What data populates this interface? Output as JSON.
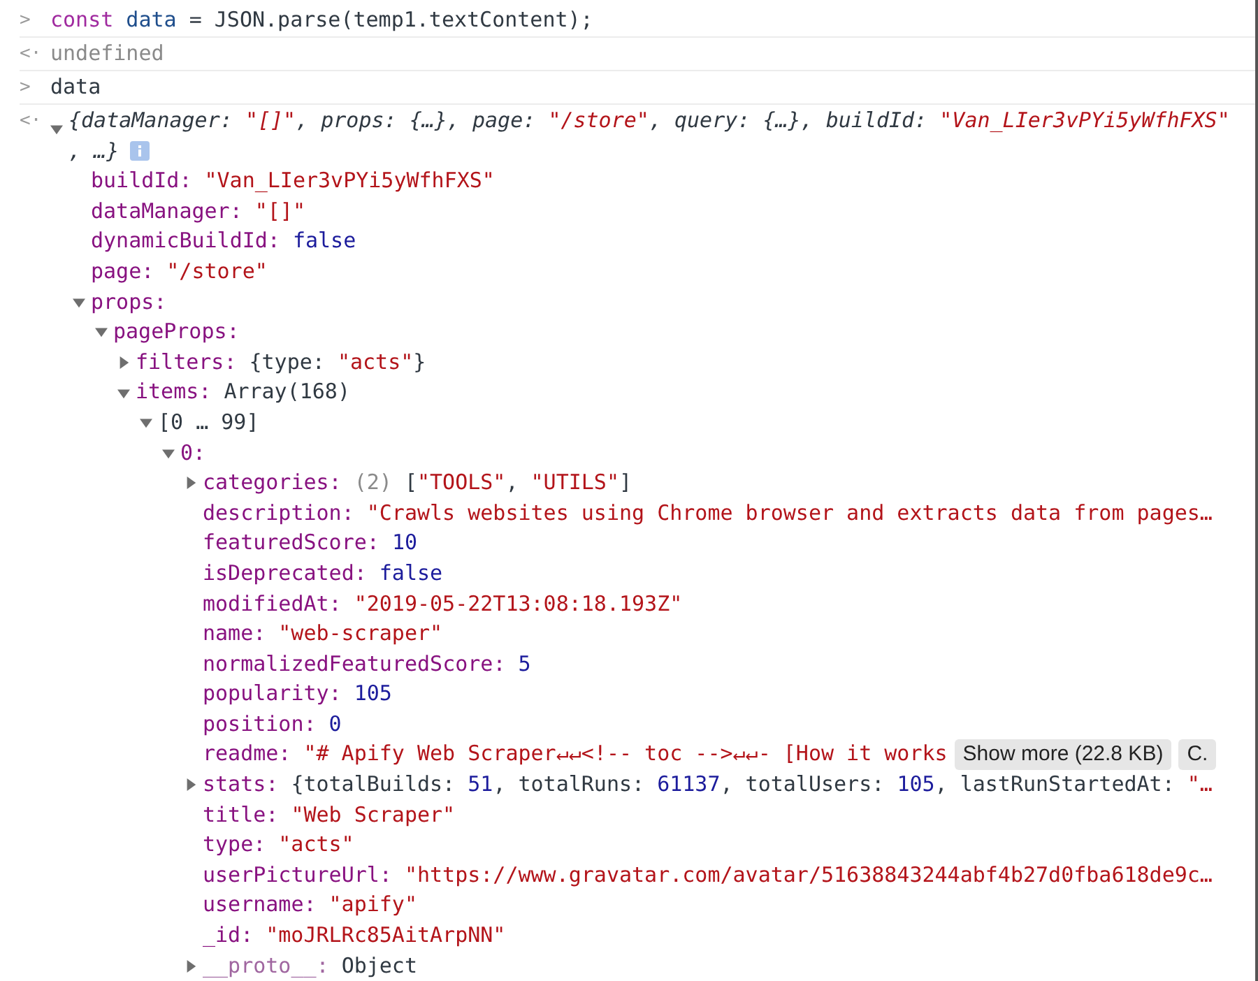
{
  "console": [
    {
      "kind": "input",
      "prompt": ">",
      "tokens": [
        {
          "kind": "keyword_purple",
          "text": "const"
        },
        {
          "kind": "variable",
          "text": " data"
        },
        {
          "kind": "plain",
          "text": " = JSON.parse(temp1.textContent);"
        }
      ]
    },
    {
      "kind": "output",
      "prompt": "<·",
      "tokens": [
        {
          "kind": "muted",
          "text": "undefined"
        }
      ]
    },
    {
      "kind": "input",
      "prompt": ">",
      "tokens": [
        {
          "kind": "plain",
          "text": "data"
        }
      ]
    },
    {
      "kind": "object",
      "prompt": "<·",
      "expanded": true,
      "summary": [
        {
          "kind": "plain",
          "text": "{dataManager: "
        },
        {
          "kind": "string",
          "text": "\"[]\""
        },
        {
          "kind": "plain",
          "text": ", props: {…}, page: "
        },
        {
          "kind": "string",
          "text": "\"/store\""
        },
        {
          "kind": "plain",
          "text": ", query: {…}, buildId: "
        },
        {
          "kind": "string",
          "text": "\"Van_LIer3vPYi5yWfhFXS"
        },
        {
          "kind": "string",
          "text": "\""
        },
        {
          "kind": "plain",
          "text": ", …}"
        }
      ],
      "children": [
        {
          "key": "buildId:",
          "value": [
            {
              "kind": "string",
              "text": "\"Van_LIer3vPYi5yWfhFXS\""
            }
          ]
        },
        {
          "key": "dataManager:",
          "value": [
            {
              "kind": "string",
              "text": "\"[]\""
            }
          ]
        },
        {
          "key": "dynamicBuildId:",
          "value": [
            {
              "kind": "number",
              "text": "false"
            }
          ]
        },
        {
          "key": "page:",
          "value": [
            {
              "kind": "string",
              "text": "\"/store\""
            }
          ]
        },
        {
          "key": "props:",
          "expanded": true,
          "children": [
            {
              "key": "pageProps:",
              "expanded": true,
              "children": [
                {
                  "key": "filters:",
                  "expanded": false,
                  "value": [
                    {
                      "kind": "plain",
                      "text": "{type: "
                    },
                    {
                      "kind": "string",
                      "text": "\"acts\""
                    },
                    {
                      "kind": "plain",
                      "text": "}"
                    }
                  ]
                },
                {
                  "key": "items:",
                  "expanded": true,
                  "value": [
                    {
                      "kind": "plain",
                      "text": "Array(168)"
                    }
                  ],
                  "children": [
                    {
                      "key": "[0 … 99]",
                      "plain_key": true,
                      "expanded": true,
                      "children": [
                        {
                          "key": "0:",
                          "expanded": true,
                          "children": [
                            {
                              "key": "categories:",
                              "expanded": false,
                              "value": [
                                {
                                  "kind": "muted",
                                  "text": "(2)"
                                },
                                {
                                  "kind": "plain",
                                  "text": " ["
                                },
                                {
                                  "kind": "string",
                                  "text": "\"TOOLS\""
                                },
                                {
                                  "kind": "plain",
                                  "text": ", "
                                },
                                {
                                  "kind": "string",
                                  "text": "\"UTILS\""
                                },
                                {
                                  "kind": "plain",
                                  "text": "]"
                                }
                              ]
                            },
                            {
                              "key": "description:",
                              "value": [
                                {
                                  "kind": "string",
                                  "text": "\"Crawls websites using Chrome browser and extracts data from pages…"
                                }
                              ]
                            },
                            {
                              "key": "featuredScore:",
                              "value": [
                                {
                                  "kind": "number",
                                  "text": "10"
                                }
                              ]
                            },
                            {
                              "key": "isDeprecated:",
                              "value": [
                                {
                                  "kind": "number",
                                  "text": "false"
                                }
                              ]
                            },
                            {
                              "key": "modifiedAt:",
                              "value": [
                                {
                                  "kind": "string",
                                  "text": "\"2019-05-22T13:08:18.193Z\""
                                }
                              ]
                            },
                            {
                              "key": "name:",
                              "value": [
                                {
                                  "kind": "string",
                                  "text": "\"web-scraper\""
                                }
                              ]
                            },
                            {
                              "key": "normalizedFeaturedScore:",
                              "value": [
                                {
                                  "kind": "number",
                                  "text": "5"
                                }
                              ]
                            },
                            {
                              "key": "popularity:",
                              "value": [
                                {
                                  "kind": "number",
                                  "text": "105"
                                }
                              ]
                            },
                            {
                              "key": "position:",
                              "value": [
                                {
                                  "kind": "number",
                                  "text": "0"
                                }
                              ]
                            },
                            {
                              "key": "readme:",
                              "value": [
                                {
                                  "kind": "string",
                                  "text": "\"# Apify Web Scraper↵↵<!-- toc -->↵↵- [How it works"
                                }
                              ],
                              "buttons": [
                                "Show more (22.8 KB)",
                                "C."
                              ]
                            },
                            {
                              "key": "stats:",
                              "expanded": false,
                              "value": [
                                {
                                  "kind": "plain",
                                  "text": "{totalBuilds: "
                                },
                                {
                                  "kind": "number",
                                  "text": "51"
                                },
                                {
                                  "kind": "plain",
                                  "text": ", totalRuns: "
                                },
                                {
                                  "kind": "number",
                                  "text": "61137"
                                },
                                {
                                  "kind": "plain",
                                  "text": ", totalUsers: "
                                },
                                {
                                  "kind": "number",
                                  "text": "105"
                                },
                                {
                                  "kind": "plain",
                                  "text": ", lastRunStartedAt: "
                                },
                                {
                                  "kind": "string",
                                  "text": "\"…"
                                }
                              ]
                            },
                            {
                              "key": "title:",
                              "value": [
                                {
                                  "kind": "string",
                                  "text": "\"Web Scraper\""
                                }
                              ]
                            },
                            {
                              "key": "type:",
                              "value": [
                                {
                                  "kind": "string",
                                  "text": "\"acts\""
                                }
                              ]
                            },
                            {
                              "key": "userPictureUrl:",
                              "value": [
                                {
                                  "kind": "string",
                                  "text": "\"https://www.gravatar.com/avatar/51638843244abf4b27d0fba618de9c…"
                                }
                              ]
                            },
                            {
                              "key": "username:",
                              "value": [
                                {
                                  "kind": "string",
                                  "text": "\"apify\""
                                }
                              ]
                            },
                            {
                              "key": "_id:",
                              "value": [
                                {
                                  "kind": "string",
                                  "text": "\"moJRLRc85AitArpNN\""
                                }
                              ]
                            },
                            {
                              "key": "__proto__:",
                              "dim_key": true,
                              "expanded": false,
                              "value": [
                                {
                                  "kind": "plain",
                                  "text": "Object"
                                }
                              ]
                            }
                          ]
                        }
                      ]
                    }
                  ]
                }
              ]
            }
          ]
        }
      ]
    }
  ]
}
